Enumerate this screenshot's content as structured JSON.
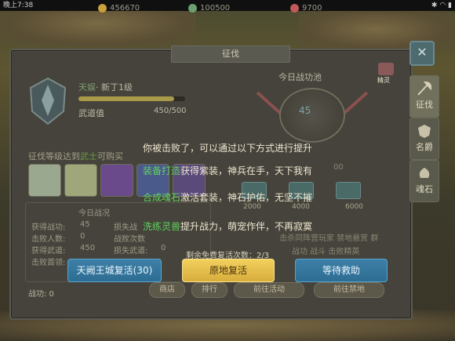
{
  "status_bar": {
    "time": "晚上7:38",
    "right_icons": "✱ ◠ ▮"
  },
  "resources": [
    {
      "icon": "coin-icon",
      "value": "456670",
      "color": "#c9a03a"
    },
    {
      "icon": "gem-icon",
      "value": "100500",
      "color": "#6ca070"
    },
    {
      "icon": "ingot-icon",
      "value": "9700",
      "color": "#c05a5a"
    }
  ],
  "panel": {
    "title": "征伐",
    "close": "✕",
    "side_tabs": [
      {
        "label": "征伐",
        "icon": "axe-icon"
      },
      {
        "label": "名爵",
        "icon": "crest-icon"
      },
      {
        "label": "魂石",
        "icon": "soulstone-icon"
      }
    ],
    "player": {
      "name": "天娱",
      "rank": "· 新丁1级",
      "exp_fraction": 0.9,
      "wudao_label": "武道值",
      "wudao_value": "450/500"
    },
    "purchase_hint": {
      "prefix": "征伐等级达到",
      "highlight": "武士",
      "suffix": "可购买"
    },
    "slots": [
      {
        "color": "#9aa890"
      },
      {
        "color": "#9ea67a"
      },
      {
        "color": "#6a4a8a"
      },
      {
        "color": "#4a5a8a"
      },
      {
        "color": "#5a4a7a"
      }
    ],
    "today": {
      "title": "今日战况",
      "left_stats": [
        {
          "label": "获得战功:",
          "value": "45"
        },
        {
          "label": "击败人数:",
          "value": "0"
        },
        {
          "label": "获得武道:",
          "value": "450"
        },
        {
          "label": "击败首领:",
          "value": ""
        }
      ],
      "right_stats": [
        {
          "label": "损失战",
          "value": ""
        },
        {
          "label": "战败次数",
          "value": ""
        },
        {
          "label": "损失武道:",
          "value": "0"
        }
      ]
    },
    "battle_power_label": "战功: 0",
    "pool": {
      "title": "今日战功池",
      "value": "45",
      "badge_label": "精灵",
      "chests": [
        "2000",
        "4000",
        "6000"
      ],
      "bg_texts": [
        "00"
      ],
      "info_lines": [
        "击杀同阵营玩家 禁地悬赏 群",
        "战功 战斗 击败精英"
      ]
    },
    "bottom_buttons": [
      {
        "label": "商店"
      },
      {
        "label": "排行"
      },
      {
        "label": "前往活动"
      },
      {
        "label": "前往禁地"
      }
    ]
  },
  "dialog": {
    "message": "你被击败了，可以通过以下方式进行提升",
    "options": [
      {
        "highlight": "装备打造",
        "text": "获得紫装，神兵在手，天下我有"
      },
      {
        "highlight": "合成魂石",
        "text": "激活套装，神石护佑，无坚不摧"
      },
      {
        "highlight": "洗练灵兽",
        "text": "提升战力，萌宠作伴，不再寂寞"
      }
    ],
    "free_revive": "剩余免费复活次数：2/3",
    "buttons": {
      "revive_city": "天阙王城复活(30)",
      "revive_here": "原地复活",
      "wait": "等待救助"
    }
  }
}
